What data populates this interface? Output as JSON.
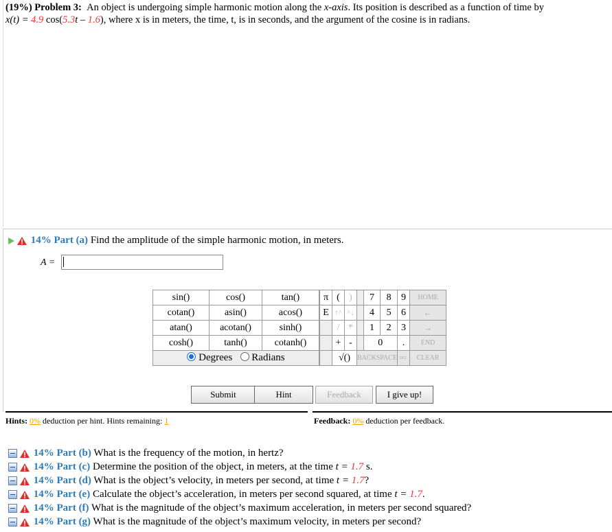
{
  "problem": {
    "weight": "(19%)",
    "title": "Problem 3:",
    "line1": "An object is undergoing simple harmonic motion along the",
    "x_axis": "x-axis",
    "line1b": ". Its position is described as a function of time by",
    "eq_lhs": "x(t) = ",
    "amp": "4.9",
    "cos": " cos(",
    "omega": "5.3",
    "t_minus": "t – ",
    "phi": "1.6",
    "rest": "), where x is in meters, the time, t, is in seconds, and the argument of the cosine is in radians."
  },
  "part_a": {
    "pct": "14% Part (a)",
    "question": "Find the amplitude of the simple harmonic motion, in meters.",
    "answer_label": "A =",
    "answer_value": ""
  },
  "calculator": {
    "functions": [
      [
        "sin()",
        "cos()",
        "tan()"
      ],
      [
        "cotan()",
        "asin()",
        "acos()"
      ],
      [
        "atan()",
        "acotan()",
        "sinh()"
      ],
      [
        "cosh()",
        "tanh()",
        "cotanh()"
      ]
    ],
    "degrees": "Degrees",
    "radians": "Radians",
    "keys": {
      "pi": "π",
      "lparen": "(",
      "rparen": ")",
      "e": "E",
      "up": "↑^",
      "pow": "^↓",
      "div": "/",
      "mul": "*",
      "plus": "+",
      "minus": "-",
      "sqrt": "√()",
      "dot": ".",
      "n0": "0",
      "n1": "1",
      "n2": "2",
      "n3": "3",
      "n4": "4",
      "n5": "5",
      "n6": "6",
      "n7": "7",
      "n8": "8",
      "n9": "9",
      "home": "HOME",
      "left": "←",
      "right": "→",
      "end": "END",
      "backspace": "BACKSPACE",
      "del": "DEL",
      "clear": "CLEAR"
    }
  },
  "buttons": {
    "submit": "Submit",
    "hint": "Hint",
    "feedback": "Feedback",
    "give_up": "I give up!"
  },
  "hints": {
    "label": "Hints:",
    "pct": "0%",
    "text": "deduction per hint. Hints remaining:",
    "remaining": "1"
  },
  "feedback": {
    "label": "Feedback:",
    "pct": "0%",
    "text": "deduction per feedback."
  },
  "parts": [
    {
      "pct": "14% Part (b)",
      "q": "What is the frequency of the motion, in hertz?"
    },
    {
      "pct": "14% Part (c)",
      "q": "Determine the position of the object, in meters, at the time",
      "var": "t = ",
      "val": "1.7",
      "end": " s."
    },
    {
      "pct": "14% Part (d)",
      "q": "What is the object’s velocity, in meters per second, at time",
      "var": "t = ",
      "val": "1.7",
      "end": "?"
    },
    {
      "pct": "14% Part (e)",
      "q": "Calculate the object’s acceleration, in meters per second squared, at time",
      "var": "t = ",
      "val": "1.7",
      "end": "."
    },
    {
      "pct": "14% Part (f)",
      "q": "What is the magnitude of the object’s maximum acceleration, in meters per second squared?"
    },
    {
      "pct": "14% Part (g)",
      "q": "What is the magnitude of the object’s maximum velocity, in meters per second?"
    }
  ]
}
